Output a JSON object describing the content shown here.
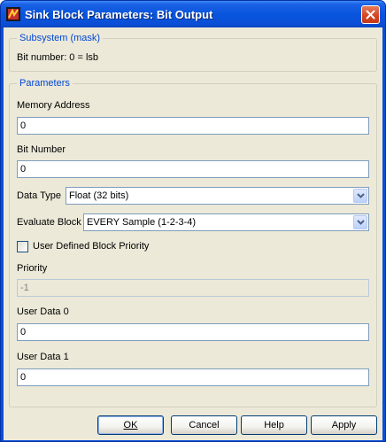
{
  "window": {
    "title": "Sink Block Parameters: Bit Output"
  },
  "subsystem": {
    "legend": "Subsystem (mask)",
    "description": "Bit number: 0 = lsb"
  },
  "parameters": {
    "legend": "Parameters",
    "memory_address": {
      "label": "Memory Address",
      "value": "0"
    },
    "bit_number": {
      "label": "Bit Number",
      "value": "0"
    },
    "data_type": {
      "label": "Data Type",
      "value": "Float (32 bits)"
    },
    "evaluate_block": {
      "label": "Evaluate Block",
      "value": "EVERY Sample (1-2-3-4)"
    },
    "user_defined_priority": {
      "label": "User Defined Block Priority",
      "checked": false
    },
    "priority": {
      "label": "Priority",
      "value": "-1"
    },
    "user_data_0": {
      "label": "User Data 0",
      "value": "0"
    },
    "user_data_1": {
      "label": "User Data 1",
      "value": "0"
    }
  },
  "buttons": {
    "ok": "OK",
    "cancel": "Cancel",
    "help": "Help",
    "apply": "Apply"
  }
}
